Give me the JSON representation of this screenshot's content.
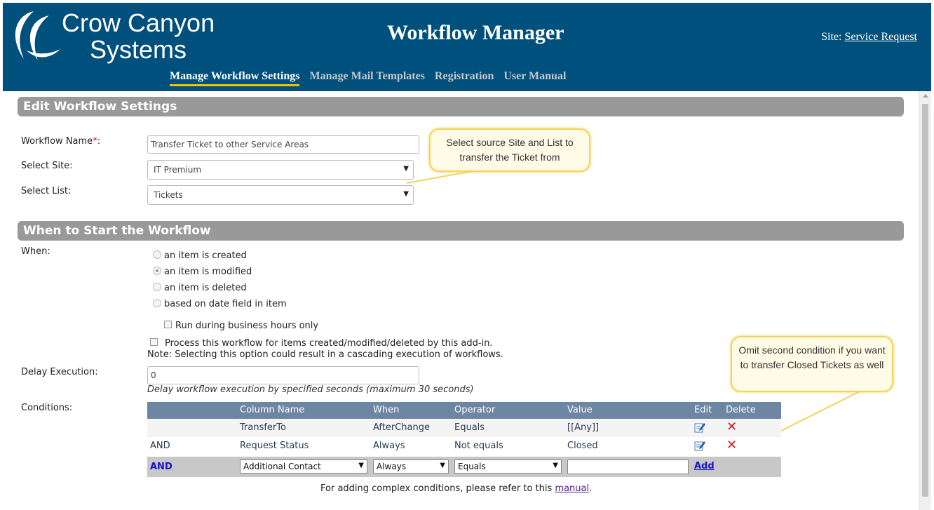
{
  "header": {
    "logo_line1": "Crow Canyon",
    "logo_line2": "Systems",
    "title": "Workflow Manager",
    "site_label": "Site:",
    "site_link": "Service Request",
    "nav": [
      {
        "label": "Manage Workflow Settings"
      },
      {
        "label": "Manage Mail Templates"
      },
      {
        "label": "Registration"
      },
      {
        "label": "User Manual"
      }
    ]
  },
  "edit_section": {
    "title": "Edit Workflow Settings",
    "workflow_name_label": "Workflow Name",
    "required_mark": "*",
    "label_colon": ":",
    "workflow_name_value": "Transfer Ticket to other Service Areas",
    "select_site_label": "Select Site:",
    "select_site_value": "IT Premium",
    "select_list_label": "Select List:",
    "select_list_value": "Tickets"
  },
  "callouts": {
    "source_callout": "Select source Site and List to transfer the Ticket from",
    "omit_callout": "Omit second condition if you want to transfer Closed Tickets as well"
  },
  "start_section": {
    "title": "When to Start the Workflow",
    "when_label": "When:",
    "options": [
      {
        "label": "an item is created",
        "checked": false
      },
      {
        "label": "an item is modified",
        "checked": true
      },
      {
        "label": "an item is deleted",
        "checked": false
      },
      {
        "label": "based on date field in item",
        "checked": false
      }
    ],
    "business_hours_label": "Run during business hours only",
    "process_label": "Process this workflow for items created/modified/deleted by this add-in.",
    "process_note": "Note: Selecting this option could result in a cascading execution of workflows.",
    "delay_label": "Delay Execution:",
    "delay_value": "0",
    "delay_note": "Delay workflow execution by specified seconds (maximum 30 seconds)",
    "conditions_label": "Conditions:"
  },
  "conditions": {
    "headers": {
      "column_name": "Column Name",
      "when": "When",
      "operator": "Operator",
      "value": "Value",
      "edit": "Edit",
      "delete": "Delete"
    },
    "rows": [
      {
        "conjunction": "",
        "column": "TransferTo",
        "when": "AfterChange",
        "operator": "Equals",
        "value": "[[Any]]"
      },
      {
        "conjunction": "AND",
        "column": "Request Status",
        "when": "Always",
        "operator": "Not equals",
        "value": "Closed"
      }
    ],
    "new_row": {
      "conjunction": "AND",
      "column": "Additional Contact",
      "when": "Always",
      "operator": "Equals",
      "value": "",
      "add_label": "Add"
    },
    "footnote_prefix": "For adding complex conditions, please refer to this",
    "footnote_link": "manual",
    "footnote_suffix": "."
  }
}
